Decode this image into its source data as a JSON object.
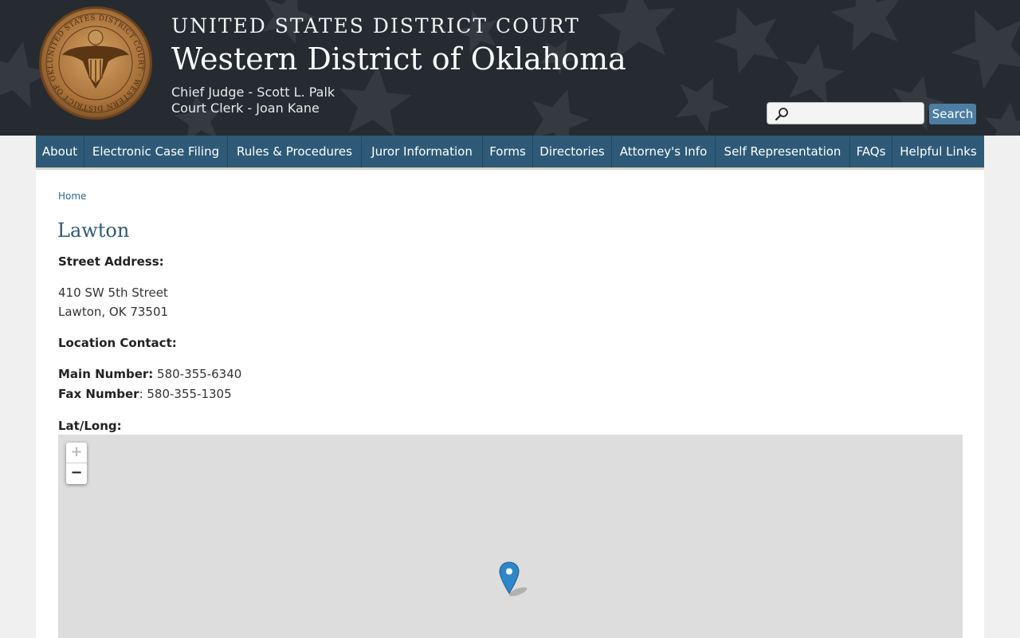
{
  "header": {
    "court_name": "UNITED STATES DISTRICT COURT",
    "district_name": "Western District of Oklahoma",
    "chief_judge": "Chief Judge - Scott L. Palk",
    "court_clerk": "Court Clerk - Joan Kane",
    "seal_text": "UNITED STATES DISTRICT COURT · WESTERN DISTRICT OF OKLAHOMA",
    "search": {
      "placeholder": "",
      "value": "",
      "button_label": "Search"
    }
  },
  "nav": {
    "items": [
      "About",
      "Electronic Case Filing",
      "Rules & Procedures",
      "Juror Information",
      "Forms",
      "Directories",
      "Attorney's Info",
      "Self Representation",
      "FAQs",
      "Helpful Links"
    ]
  },
  "breadcrumb": {
    "home": "Home"
  },
  "page": {
    "title": "Lawton",
    "street_address_label": "Street Address:",
    "address_line1": "410 SW 5th Street",
    "address_line2": "Lawton, OK 73501",
    "location_contact_label": "Location Contact:",
    "main_number_label": "Main Number:",
    "main_number": " 580-355-6340",
    "fax_number_label": "Fax Number",
    "fax_number": ": 580-355-1305",
    "latlong_label": "Lat/Long:"
  },
  "map": {
    "zoom_in": "+",
    "zoom_out": "−"
  },
  "colors": {
    "header_bg": "#262b31",
    "nav_bg": "#2e5a78",
    "accent_blue": "#4c7ea3",
    "title_color": "#2e5a78",
    "map_bg": "#dddddd",
    "marker_blue": "#2f86c8"
  },
  "icons": {
    "seal": "court-seal",
    "search": "magnifier-icon",
    "marker": "map-marker-icon"
  }
}
